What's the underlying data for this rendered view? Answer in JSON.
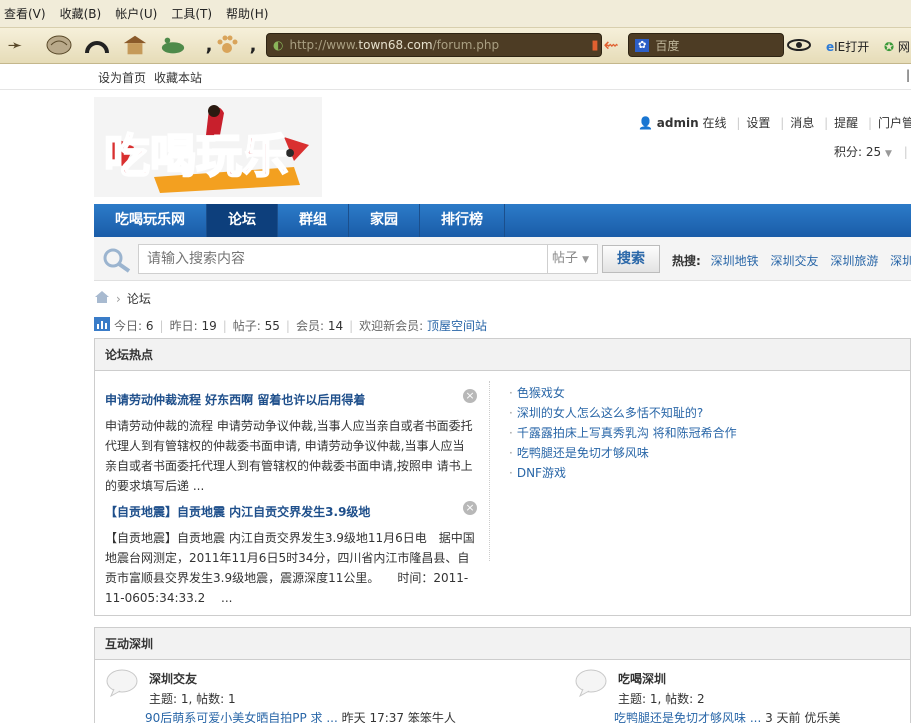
{
  "browser": {
    "menu": [
      "查看(V)",
      "收藏(B)",
      "帐户(U)",
      "工具(T)",
      "帮助(H)"
    ],
    "address": {
      "prefix": "http://www.",
      "domain": "town68.com",
      "path": "/forum.php"
    },
    "search_placeholder": "百度",
    "ie_open": "IE打开",
    "ie_next": "网"
  },
  "site": {
    "top_links": [
      "设为首页",
      "收藏本站"
    ],
    "logo_text": "吃喝玩乐",
    "user": {
      "name": "admin",
      "status": "在线",
      "links": [
        "设置",
        "消息",
        "提醒",
        "门户管理",
        "管"
      ],
      "credits_label": "积分: 25"
    },
    "nav": [
      "吃喝玩乐网",
      "论坛",
      "群组",
      "家园",
      "排行榜"
    ],
    "search": {
      "placeholder": "请输入搜索内容",
      "type": "帖子",
      "button": "搜索",
      "hot_label": "热搜:",
      "hot_terms": [
        "深圳地铁",
        "深圳交友",
        "深圳旅游",
        "深圳美"
      ]
    },
    "breadcrumb": "论坛",
    "stats": {
      "today_label": "今日:",
      "today": "6",
      "yesterday_label": "昨日:",
      "yesterday": "19",
      "posts_label": "帖子:",
      "posts": "55",
      "members_label": "会员:",
      "members": "14",
      "welcome_label": "欢迎新会员:",
      "new_member": "顶屋空间站"
    },
    "hot_section": {
      "title": "论坛热点",
      "articles": [
        {
          "title": "申请劳动仲裁流程 好东西啊 留着也许以后用得着",
          "body": "申请劳动仲裁的流程 申请劳动争议仲裁,当事人应当亲自或者书面委托代理人到有管辖权的仲裁委书面申请, 申请劳动争议仲裁,当事人应当亲自或者书面委托代理人到有管辖权的仲裁委书面申请,按照申 请书上的要求填写后递 ..."
        },
        {
          "title": "【自贡地震】自贡地震 内江自贡交界发生3.9级地",
          "body": "【自贡地震】自贡地震 内江自贡交界发生3.9级地11月6日电　据中国地震台网测定，2011年11月6日5时34分，四川省内江市隆昌县、自贡市富顺县交界发生3.9级地震，震源深度11公里。　　时间：2011-11-0605:34:33.2　 ..."
        }
      ],
      "list": [
        "色猴戏女",
        "深圳的女人怎么这么多恬不知耻的?",
        "千露露拍床上写真秀乳沟 将和陈冠希合作",
        "吃鸭腿还是免切才够风味",
        "DNF游戏"
      ]
    },
    "interaction_section": {
      "title": "互动深圳",
      "forums": [
        {
          "name": "深圳交友",
          "meta": "主题: 1, 帖数: 1",
          "last_link": "90后萌系可爱小美女晒自拍PP 求 ...",
          "last_time": "昨天 17:37",
          "last_user": "笨笨牛人"
        },
        {
          "name": "吃喝深圳",
          "meta": "主题: 1, 帖数: 2",
          "last_link": "吃鸭腿还是免切才够风味 ...",
          "last_time": "3 天前",
          "last_user": "优乐美"
        }
      ]
    }
  }
}
